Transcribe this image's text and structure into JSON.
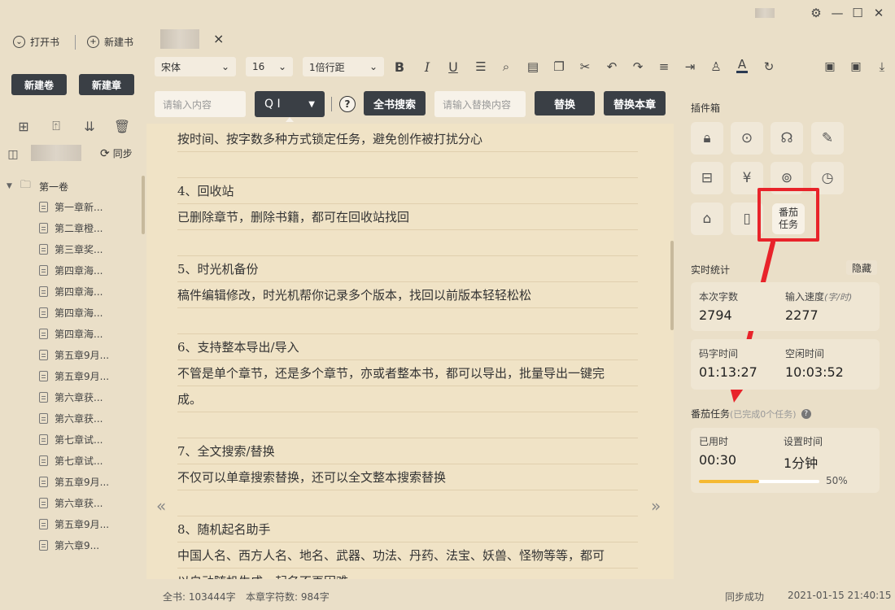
{
  "tabbar": {
    "open_book": "打开书",
    "new_book": "新建书",
    "close": "×"
  },
  "toolbar": {
    "font": "宋体",
    "size": "16",
    "line_spacing": "1倍行距",
    "bold": "B",
    "italic": "I",
    "underline": "U",
    "color_letter": "A"
  },
  "sidebar": {
    "new_volume": "新建卷",
    "new_chapter": "新建章",
    "sync": "同步",
    "volume": "第一卷",
    "chapters": [
      "第一章新...",
      "第二章橙...",
      "第三章奖...",
      "第四章海...",
      "第四章海...",
      "第四章海...",
      "第四章海...",
      "第五章9月...",
      "第五章9月...",
      "第六章获...",
      "第六章获...",
      "第七章试...",
      "第七章试...",
      "第五章9月...",
      "第六章获...",
      "第五章9月...",
      "第六章9..."
    ]
  },
  "search": {
    "input_placeholder": "请输入内容",
    "mode": "Q I",
    "help": "?",
    "search_all": "全书搜索",
    "replace_placeholder": "请输入替换内容",
    "replace": "替换",
    "replace_chapter": "替换本章"
  },
  "editor": {
    "lines": [
      "按时间、按字数多种方式锁定任务，避免创作被打扰分心",
      "",
      "4、回收站",
      "已删除章节，删除书籍，都可在回收站找回",
      "",
      "5、时光机备份",
      "稿件编辑修改，时光机帮你记录多个版本，找回以前版本轻轻松松",
      "",
      "6、支持整本导出/导入",
      "不管是单个章节，还是多个章节，亦或者整本书，都可以导出，批量导出一键完",
      "成。",
      "",
      "7、全文搜索/替换",
      "不仅可以单章搜索替换，还可以全文整本搜索替换",
      "",
      "8、随机起名助手",
      "中国人名、西方人名、地名、武器、功法、丹药、法宝、妖兽、怪物等等，都可",
      "以自动随机生成，起名不再困难"
    ],
    "prev": "«",
    "next": "»"
  },
  "plugins": {
    "title": "插件箱",
    "tomato_task": "番茄\n任务"
  },
  "stats": {
    "title": "实时统计",
    "hide": "隐藏",
    "words_label": "本次字数",
    "words_value": "2794",
    "speed_label": "输入速度",
    "speed_unit": "(字/时)",
    "speed_value": "2277",
    "typing_label": "码字时间",
    "typing_value": "01:13:27",
    "idle_label": "空闲时间",
    "idle_value": "10:03:52"
  },
  "tomato": {
    "title": "番茄任务",
    "done": "(已完成0个任务)",
    "help": "?",
    "used_label": "已用时",
    "used_value": "00:30",
    "set_label": "设置时间",
    "set_value": "1分钟",
    "progress": 0.5,
    "progress_text": "50%"
  },
  "status": {
    "book_words": "全书: 103444字",
    "chapter_words": "本章字符数: 984字",
    "sync": "同步成功",
    "datetime": "2021-01-15 21:40:15"
  },
  "colors": {
    "accent": "#f5b932",
    "highlight": "#e8232a",
    "dark_button": "#3a3f45"
  }
}
